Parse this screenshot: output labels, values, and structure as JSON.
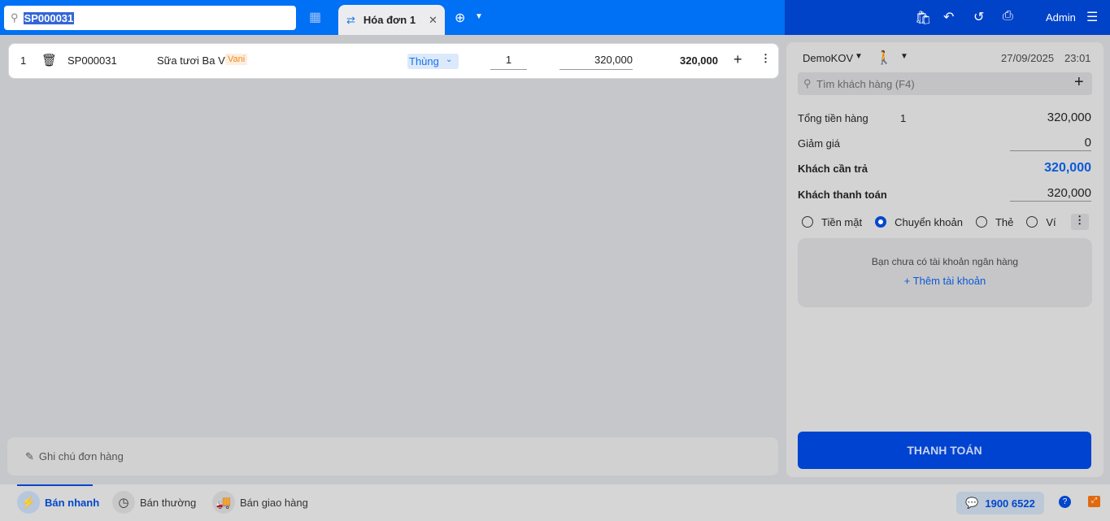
{
  "search": {
    "value": "SP000031"
  },
  "tab": {
    "label": "Hóa đơn 1"
  },
  "header": {
    "user": "Admin"
  },
  "cart": [
    {
      "index": "1",
      "code": "SP000031",
      "name": "Sữa tươi Ba Vì",
      "variant": "Vani",
      "unit": "Thùng",
      "qty": "1",
      "price": "320,000",
      "total": "320,000"
    }
  ],
  "note": {
    "placeholder": "Ghi chú đơn hàng"
  },
  "bottom": {
    "tabs": [
      "Bán nhanh",
      "Bán thường",
      "Bán giao hàng"
    ],
    "hotline": "1900 6522"
  },
  "panel": {
    "branch": "DemoKOV",
    "date": "27/09/2025",
    "time": "23:01",
    "customer_placeholder": "Tìm khách hàng (F4)",
    "total_label": "Tổng tiền hàng",
    "total_qty": "1",
    "total": "320,000",
    "discount_label": "Giảm giá",
    "discount": "0",
    "due_label": "Khách cần trả",
    "due": "320,000",
    "paid_label": "Khách thanh toán",
    "paid": "320,000",
    "methods": [
      "Tiền mặt",
      "Chuyển khoản",
      "Thẻ",
      "Ví"
    ],
    "no_bank": "Bạn chưa có tài khoản ngân hàng",
    "add_account": "+ Thêm tài khoản",
    "pay_button": "THANH TOÁN"
  }
}
